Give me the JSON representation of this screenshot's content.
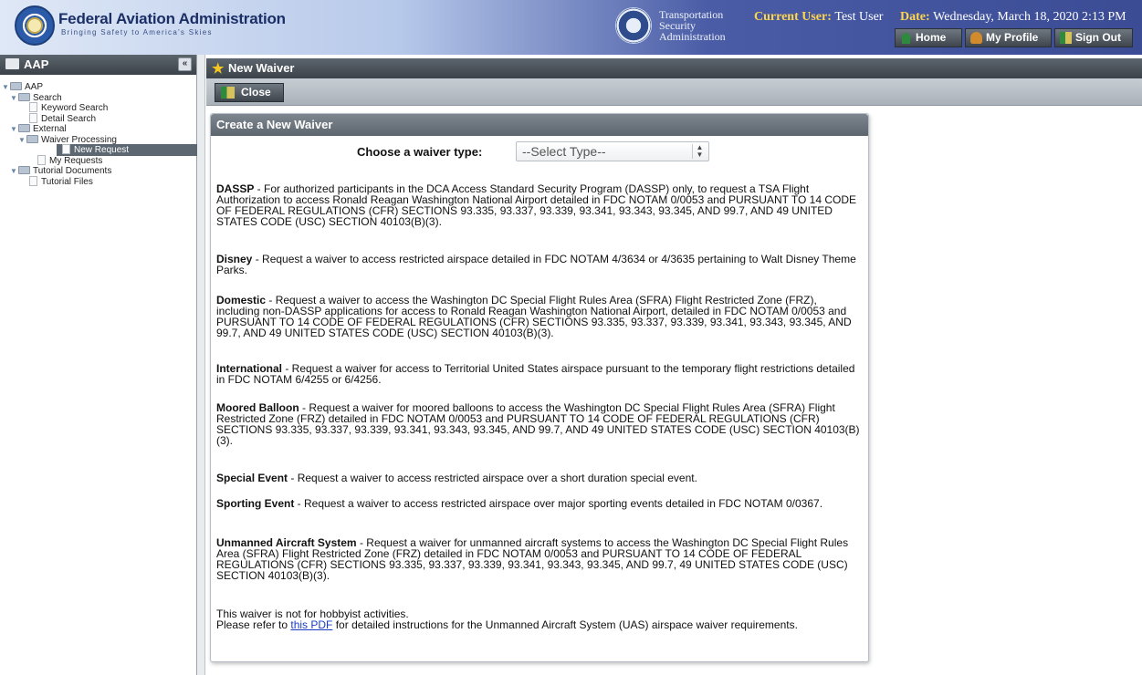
{
  "header": {
    "faa_title": "Federal Aviation Administration",
    "faa_tagline": "Bringing Safety to America's Skies",
    "tsa_lines": [
      "Transportation",
      "Security",
      "Administration"
    ],
    "user_label": "Current User:",
    "user_value": "Test User",
    "date_label": "Date:",
    "date_value": "Wednesday, March 18, 2020 2:13 PM",
    "buttons": {
      "home": "Home",
      "profile": "My Profile",
      "signout": "Sign Out"
    }
  },
  "sidebar": {
    "title": "AAP",
    "collapse_glyph": "«",
    "tree": [
      {
        "label": "AAP",
        "level": 0,
        "kind": "folder",
        "selected": false
      },
      {
        "label": "Search",
        "level": 1,
        "kind": "folder",
        "selected": false
      },
      {
        "label": "Keyword Search",
        "level": 2,
        "kind": "page",
        "selected": false
      },
      {
        "label": "Detail Search",
        "level": 2,
        "kind": "page",
        "selected": false
      },
      {
        "label": "External",
        "level": 1,
        "kind": "folder",
        "selected": false
      },
      {
        "label": "Waiver Processing",
        "level": 2,
        "kind": "folder",
        "selected": false
      },
      {
        "label": "New Request",
        "level": 3,
        "kind": "page",
        "selected": true
      },
      {
        "label": "My Requests",
        "level": 3,
        "kind": "page",
        "selected": false
      },
      {
        "label": "Tutorial Documents",
        "level": 1,
        "kind": "folder",
        "selected": false
      },
      {
        "label": "Tutorial Files",
        "level": 2,
        "kind": "page",
        "selected": false
      }
    ]
  },
  "main": {
    "title": "New Waiver",
    "close_label": "Close",
    "panel_title": "Create a New Waiver",
    "type_label": "Choose a waiver type:",
    "type_selected": "--Select Type--",
    "descriptions": [
      {
        "name": "DASSP",
        "text": " - For authorized participants in the DCA Access Standard Security Program (DASSP) only, to request a TSA Flight Authorization to access Ronald Reagan Washington National Airport detailed in FDC NOTAM 0/0053 and PURSUANT TO 14 CODE OF FEDERAL REGULATIONS (CFR) SECTIONS 93.335, 93.337, 93.339, 93.341, 93.343, 93.345, AND 99.7, AND 49 UNITED STATES CODE (USC) SECTION 40103(B)(3)."
      },
      {
        "name": "Disney",
        "text": " - Request a waiver to access restricted airspace detailed in FDC NOTAM 4/3634 or 4/3635 pertaining to Walt Disney Theme Parks."
      },
      {
        "name": "Domestic",
        "text": " - Request a waiver to access the Washington DC Special Flight Rules Area (SFRA) Flight Restricted Zone (FRZ), including non-DASSP applications for access to Ronald Reagan Washington National Airport, detailed in FDC NOTAM 0/0053 and PURSUANT TO 14 CODE OF FEDERAL REGULATIONS (CFR) SECTIONS 93.335, 93.337, 93.339, 93.341, 93.343, 93.345, AND 99.7, AND 49 UNITED STATES CODE (USC) SECTION 40103(B)(3)."
      },
      {
        "name": "International",
        "text": " - Request a waiver for access to Territorial United States airspace pursuant to the temporary flight restrictions detailed in FDC NOTAM 6/4255 or 6/4256."
      },
      {
        "name": "Moored Balloon",
        "text": " - Request a waiver for moored balloons to access the Washington DC Special Flight Rules Area (SFRA) Flight Restricted Zone (FRZ) detailed in FDC NOTAM 0/0053 and PURSUANT TO 14 CODE OF FEDERAL REGULATIONS (CFR) SECTIONS 93.335, 93.337, 93.339, 93.341, 93.343, 93.345, AND 99.7, AND 49 UNITED STATES CODE (USC) SECTION 40103(B)(3)."
      },
      {
        "name": "Special Event",
        "text": " - Request a waiver to access restricted airspace over a short duration special event."
      },
      {
        "name": "Sporting Event",
        "text": " - Request a waiver to access restricted airspace over major sporting events detailed in FDC NOTAM 0/0367."
      },
      {
        "name": "Unmanned Aircraft System",
        "text": " - Request a waiver for unmanned aircraft systems to access the Washington DC Special Flight Rules Area (SFRA) Flight Restricted Zone (FRZ) detailed in FDC NOTAM 0/0053 and PURSUANT TO 14 CODE OF FEDERAL REGULATIONS (CFR) SECTIONS 93.335, 93.337, 93.339, 93.341, 93.343, 93.345, AND 99.7, 49 UNITED STATES CODE (USC) SECTION 40103(B)(3)."
      }
    ],
    "note_line1": "This waiver is not for hobbyist activities.",
    "note_pre": "Please refer to ",
    "note_link": "this PDF",
    "note_post": " for detailed instructions for the Unmanned Aircraft System (UAS) airspace waiver requirements."
  }
}
